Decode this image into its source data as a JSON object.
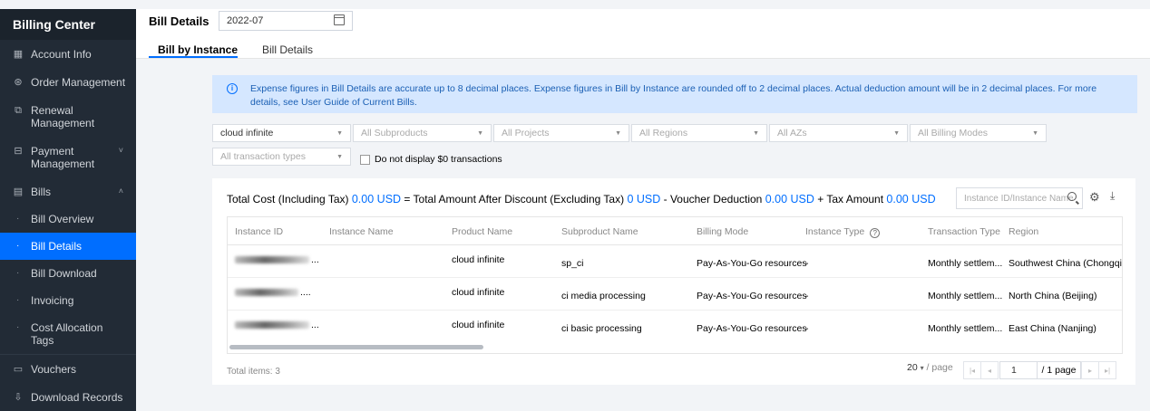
{
  "sidebar": {
    "title": "Billing Center",
    "items": [
      {
        "label": "Account Info",
        "icon": "grid-icon"
      },
      {
        "label": "Order Management",
        "icon": "order-icon"
      },
      {
        "label": "Renewal Management",
        "icon": "renewal-icon"
      },
      {
        "label": "Payment Management",
        "icon": "payment-icon",
        "caret": "˅"
      },
      {
        "label": "Bills",
        "icon": "bills-icon",
        "caret": "˄"
      }
    ],
    "bills_sub": [
      {
        "label": "Bill Overview"
      },
      {
        "label": "Bill Details",
        "active": true
      },
      {
        "label": "Bill Download"
      },
      {
        "label": "Invoicing"
      },
      {
        "label": "Cost Allocation Tags"
      }
    ],
    "bottom_items": [
      {
        "label": "Vouchers",
        "icon": "voucher-icon"
      },
      {
        "label": "Download Records",
        "icon": "download-records-icon"
      }
    ]
  },
  "header": {
    "title": "Bill Details",
    "date": "2022-07",
    "tabs": [
      "Bill by Instance",
      "Bill Details"
    ]
  },
  "notice": {
    "text": "Expense figures in Bill Details are accurate up to 8 decimal places. Expense figures in Bill by Instance are rounded off to 2 decimal places. Actual deduction amount will be in 2 decimal places. For more details, see User Guide of Current Bills."
  },
  "filters": {
    "product": "cloud infinite",
    "subproducts": "All Subproducts",
    "projects": "All Projects",
    "regions": "All Regions",
    "azs": "All AZs",
    "billing_modes": "All Billing Modes",
    "transaction_types": "All transaction types",
    "hide_zero_label": "Do not display $0 transactions"
  },
  "summary": {
    "total_label": "Total Cost (Including Tax)",
    "total_value": "0.00 USD",
    "after_discount_label": "= Total Amount After Discount (Excluding Tax)",
    "after_discount_value": "0 USD",
    "voucher_label": "- Voucher Deduction",
    "voucher_value": "0.00 USD",
    "tax_label": "+ Tax Amount",
    "tax_value": "0.00 USD"
  },
  "search": {
    "placeholder": "Instance ID/Instance Name"
  },
  "table": {
    "columns": [
      "Instance ID",
      "Instance Name",
      "Product Name",
      "Subproduct Name",
      "Billing Mode",
      "Instance Type",
      "Transaction Type",
      "Region"
    ],
    "rows": [
      {
        "instance_id": "...",
        "instance_name": "",
        "product": "cloud infinite",
        "subproduct": "sp_ci",
        "billing_mode": "Pay-As-You-Go resources",
        "instance_type": "-",
        "transaction_type": "Monthly settlem...",
        "region": "Southwest China (Chongqing)"
      },
      {
        "instance_id": "....",
        "instance_name": "",
        "product": "cloud infinite",
        "subproduct": "ci media processing",
        "billing_mode": "Pay-As-You-Go resources",
        "instance_type": "-",
        "transaction_type": "Monthly settlem...",
        "region": "North China (Beijing)"
      },
      {
        "instance_id": "...",
        "instance_name": "",
        "product": "cloud infinite",
        "subproduct": "ci basic processing",
        "billing_mode": "Pay-As-You-Go resources",
        "instance_type": "-",
        "transaction_type": "Monthly settlem...",
        "region": "East China (Nanjing)"
      }
    ]
  },
  "footer": {
    "total_items": "Total items: 3",
    "page_size": "20",
    "per_page": "/ page",
    "page_input": "1",
    "page_total": "/ 1 page"
  }
}
